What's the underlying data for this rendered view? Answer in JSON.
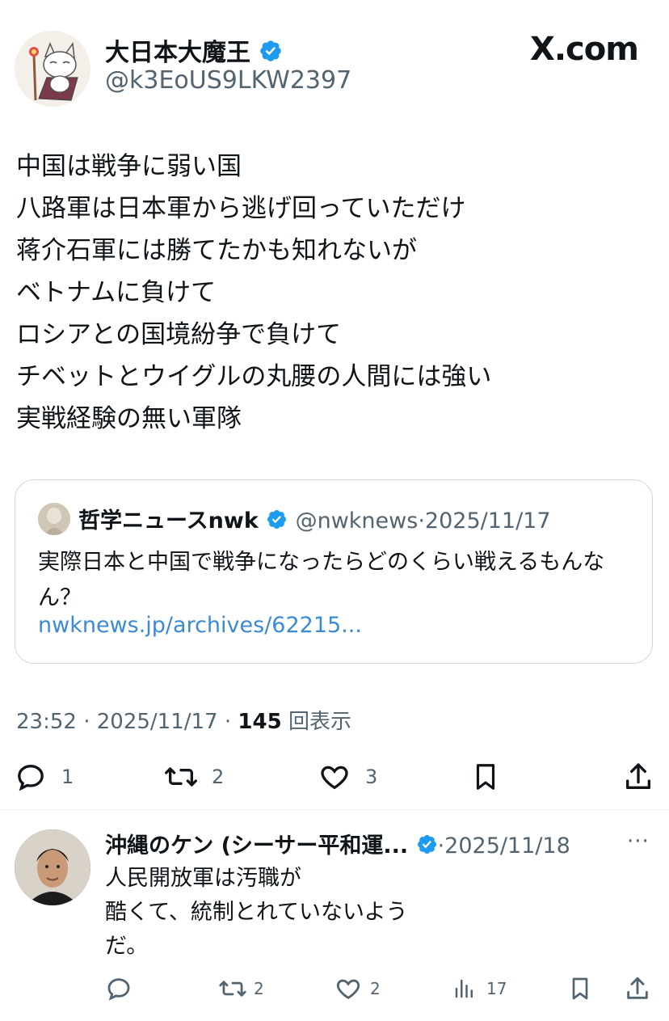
{
  "post": {
    "author_name": "大日本大魔王",
    "author_handle": "@k3EoUS9LKW2397",
    "brand": "X.com",
    "lines": [
      "中国は戦争に弱い国",
      "八路軍は日本軍から逃げ回っていただけ",
      "蒋介石軍には勝てたかも知れないが",
      "ベトナムに負けて",
      "ロシアとの国境紛争で負けて",
      "チベットとウイグルの丸腰の人間には強い",
      "実戦経験の無い軍隊"
    ],
    "quote": {
      "author_name": "哲学ニュースnwk",
      "author_handle": "@nwknews",
      "date": "2025/11/17",
      "text": "実際日本と中国で戦争になったらどのくらい戦えるもんなん？",
      "link": "nwknews.jp/archives/62215..."
    },
    "time": "23:52",
    "date": "2025/11/17",
    "views_count": "145",
    "views_label": "回表示",
    "replies": "1",
    "reposts": "2",
    "likes": "3"
  },
  "reply": {
    "author_name": "沖縄のケン (シーサー平和運...",
    "date": "2025/11/18",
    "more": "···",
    "lines": [
      "人民開放軍は汚職が",
      "酷くて、統制とれていないよう",
      "だ。"
    ],
    "reposts": "2",
    "likes": "2",
    "views": "17"
  },
  "colors": {
    "verified": "#1d9bf0",
    "link": "#3b8ad6",
    "muted": "#536471"
  }
}
